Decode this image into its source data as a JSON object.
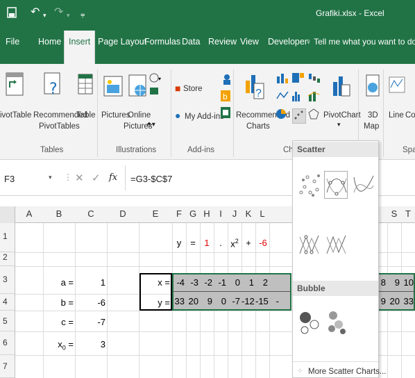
{
  "titlebar": {
    "title": "Grafiki.xlsx - Excel"
  },
  "tabs": [
    {
      "label": "File"
    },
    {
      "label": "Home"
    },
    {
      "label": "Insert"
    },
    {
      "label": "Page Layout"
    },
    {
      "label": "Formulas"
    },
    {
      "label": "Data"
    },
    {
      "label": "Review"
    },
    {
      "label": "View"
    },
    {
      "label": "Developer"
    },
    {
      "label": "Tell me what you want to do..."
    }
  ],
  "ribbon": {
    "pivot_table": "ivotTable",
    "recommended_pivot_l1": "Recommended",
    "recommended_pivot_l2": "PivotTables",
    "table": "Table",
    "group_tables": "Tables",
    "pictures": "Pictures",
    "online_pictures_l1": "Online",
    "online_pictures_l2": "Pictures",
    "group_illustrations": "Illustrations",
    "store": "Store",
    "my_addins": "My Add-ins",
    "group_addins": "Add-ins",
    "recommended_charts_l1": "Recommended",
    "recommended_charts_l2": "Charts",
    "group_charts": "Cha",
    "pivot_chart": "PivotChart",
    "map_3d_l1": "3D",
    "map_3d_l2": "Map",
    "line": "Line",
    "column": "Col",
    "group_sparklines": "Spar"
  },
  "formula_bar": {
    "name_box": "F3",
    "fx": "fx",
    "formula": "=G3-$C$7"
  },
  "columns": [
    "A",
    "B",
    "C",
    "D",
    "E",
    "F",
    "G",
    "H",
    "I",
    "J",
    "K",
    "L",
    "S",
    "T"
  ],
  "rows": [
    "1",
    "2",
    "3",
    "4",
    "5",
    "6",
    "7"
  ],
  "cells": {
    "f1": "y",
    "g1": "=",
    "h1": "1",
    "i1": ".",
    "j1": "x",
    "j1sup": "2",
    "k1": "+",
    "l1": "-6",
    "b3": "a =",
    "c3": "1",
    "e3": "x =",
    "x": [
      "-4",
      "-3",
      "-2",
      "-1",
      "0",
      "1",
      "2"
    ],
    "b4": "b =",
    "c4": "-6",
    "e4": "y =",
    "y": [
      "33",
      "20",
      "9",
      "0",
      "-7",
      "-12",
      "-15"
    ],
    "y_trunc": "-",
    "b5": "c =",
    "c5": "-7",
    "b6": "x",
    "b6sub": "0",
    "b6eq": " =",
    "c6": "3",
    "rx": [
      "8",
      "9",
      "10"
    ],
    "ry": [
      "9",
      "20",
      "33"
    ]
  },
  "dropdown": {
    "scatter_header": "Scatter",
    "bubble_header": "Bubble",
    "more": "More Scatter Charts..."
  },
  "colors": {
    "excel_green": "#217346",
    "ribbon_bg": "#f3f3f3",
    "red_value": "#e00000"
  }
}
